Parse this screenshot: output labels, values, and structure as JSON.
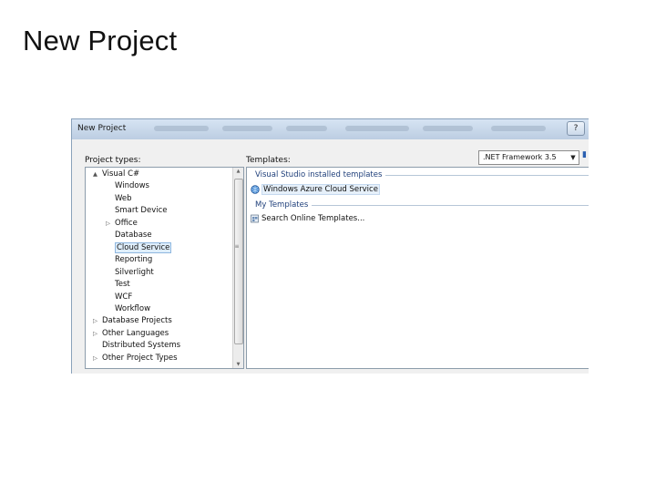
{
  "slide": {
    "title": "New Project"
  },
  "dialog": {
    "title": "New Project",
    "help_label": "?",
    "project_types_label": "Project types:",
    "templates_label": "Templates:",
    "framework": {
      "value": ".NET Framework 3.5"
    },
    "project_types": [
      {
        "label": "Visual C#",
        "level": 0,
        "expander": "▲",
        "selected": false
      },
      {
        "label": "Windows",
        "level": 1,
        "expander": "",
        "selected": false
      },
      {
        "label": "Web",
        "level": 1,
        "expander": "",
        "selected": false
      },
      {
        "label": "Smart Device",
        "level": 1,
        "expander": "",
        "selected": false
      },
      {
        "label": "Office",
        "level": 1,
        "expander": "▷",
        "selected": false
      },
      {
        "label": "Database",
        "level": 1,
        "expander": "",
        "selected": false
      },
      {
        "label": "Cloud Service",
        "level": 1,
        "expander": "",
        "selected": true
      },
      {
        "label": "Reporting",
        "level": 1,
        "expander": "",
        "selected": false
      },
      {
        "label": "Silverlight",
        "level": 1,
        "expander": "",
        "selected": false
      },
      {
        "label": "Test",
        "level": 1,
        "expander": "",
        "selected": false
      },
      {
        "label": "WCF",
        "level": 1,
        "expander": "",
        "selected": false
      },
      {
        "label": "Workflow",
        "level": 1,
        "expander": "",
        "selected": false
      },
      {
        "label": "Database Projects",
        "level": 0,
        "expander": "▷",
        "selected": false
      },
      {
        "label": "Other Languages",
        "level": 0,
        "expander": "▷",
        "selected": false
      },
      {
        "label": "Distributed Systems",
        "level": 0,
        "expander": "",
        "selected": false
      },
      {
        "label": "Other Project Types",
        "level": 0,
        "expander": "▷",
        "selected": false
      }
    ],
    "template_groups": {
      "installed": {
        "header": "Visual Studio installed templates",
        "items": [
          {
            "label": "Windows Azure Cloud Service",
            "icon": "globe-icon"
          }
        ]
      },
      "mine": {
        "header": "My Templates",
        "items": [
          {
            "label": "Search Online Templates...",
            "icon": "search-templates-icon"
          }
        ]
      }
    }
  }
}
